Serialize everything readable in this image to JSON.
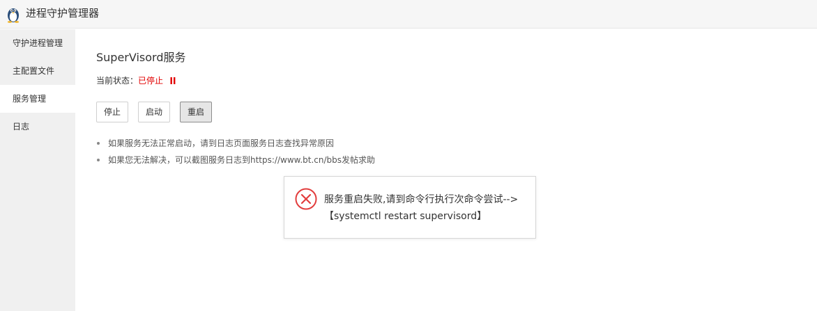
{
  "app": {
    "title": "进程守护管理器",
    "icon": "linux-penguin-icon"
  },
  "sidebar": {
    "items": [
      {
        "label": "守护进程管理",
        "active": false
      },
      {
        "label": "主配置文件",
        "active": false
      },
      {
        "label": "服务管理",
        "active": true
      },
      {
        "label": "日志",
        "active": false
      }
    ]
  },
  "service": {
    "title": "SuperVisord服务",
    "status_label": "当前状态：",
    "status_value": "已停止",
    "status_color": "#e20000",
    "status_icon": "pause-icon"
  },
  "buttons": {
    "stop": "停止",
    "start": "启动",
    "restart": "重启"
  },
  "tips": [
    "如果服务无法正常启动，请到日志页面服务日志查找异常原因",
    "如果您无法解决，可以截图服务日志到https://www.bt.cn/bbs发帖求助"
  ],
  "dialog": {
    "icon": "error-circle-icon",
    "icon_color": "#e23d3d",
    "message": "服务重启失败,请到命令行执行次命令尝试-->【systemctl restart supervisord】"
  }
}
